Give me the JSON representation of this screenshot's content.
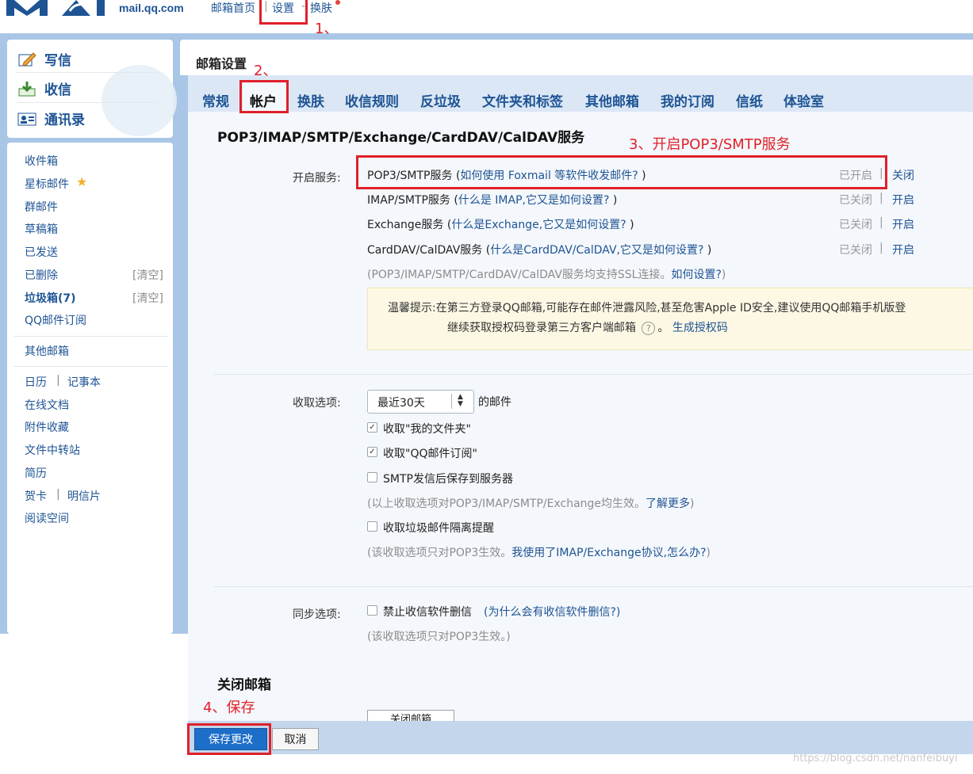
{
  "header": {
    "domain": "mail.qq.com",
    "nav": [
      {
        "label": "邮箱首页"
      },
      {
        "label": "设置"
      },
      {
        "label": "换肤"
      }
    ]
  },
  "sidebar": {
    "primary": [
      {
        "label": "写信",
        "icon": "pencil-icon"
      },
      {
        "label": "收信",
        "icon": "inbox-download-icon"
      },
      {
        "label": "通讯录",
        "icon": "contact-card-icon"
      }
    ],
    "folders": [
      {
        "label": "收件箱"
      },
      {
        "label": "星标邮件"
      },
      {
        "label": "群邮件"
      },
      {
        "label": "草稿箱"
      },
      {
        "label": "已发送"
      },
      {
        "label": "已删除",
        "action": "[清空]"
      },
      {
        "label": "垃圾箱(7)",
        "action": "[清空]"
      },
      {
        "label": "QQ邮件订阅"
      }
    ],
    "other_mail": "其他邮箱",
    "tools": {
      "calendar": "日历",
      "notes": "记事本",
      "online_docs": "在线文档",
      "attachments": "附件收藏",
      "file_transfer": "文件中转站",
      "resume": "简历",
      "greeting_card": "贺卡",
      "postcard": "明信片",
      "reading_space": "阅读空间"
    },
    "tool_sep": "|"
  },
  "main": {
    "title": "邮箱设置",
    "tabs": [
      {
        "label": "常规"
      },
      {
        "label": "帐户"
      },
      {
        "label": "换肤"
      },
      {
        "label": "收信规则"
      },
      {
        "label": "反垃圾"
      },
      {
        "label": "文件夹和标签"
      },
      {
        "label": "其他邮箱"
      },
      {
        "label": "我的订阅"
      },
      {
        "label": "信纸"
      },
      {
        "label": "体验室"
      }
    ],
    "services": {
      "title": "POP3/IMAP/SMTP/Exchange/CardDAV/CalDAV服务",
      "label": "开启服务:",
      "rows": [
        {
          "name": "POP3/SMTP服务",
          "help": "如何使用 Foxmail 等软件收发邮件?",
          "status": "已开启",
          "action": "关闭"
        },
        {
          "name": "IMAP/SMTP服务",
          "help": "什么是 IMAP,它又是如何设置?",
          "status": "已关闭",
          "action": "开启"
        },
        {
          "name": "Exchange服务",
          "help": "什么是Exchange,它又是如何设置?",
          "status": "已关闭",
          "action": "开启"
        },
        {
          "name": "CardDAV/CalDAV服务",
          "help": "什么是CardDAV/CalDAV,它又是如何设置?",
          "status": "已关闭",
          "action": "开启"
        }
      ],
      "ssl_note_prefix": "(POP3/IMAP/SMTP/CardDAV/CalDAV服务均支持SSL连接。",
      "ssl_note_link": "如何设置?",
      "ssl_note_suffix": ")",
      "tip_line1": "温馨提示:在第三方登录QQ邮箱,可能存在邮件泄露风险,甚至危害Apple ID安全,建议使用QQ邮箱手机版登",
      "tip_line2": "继续获取授权码登录第三方客户端邮箱",
      "tip_link": "生成授权码"
    },
    "fetch": {
      "label": "收取选项:",
      "select_value": "最近30天",
      "select_suffix": "的邮件",
      "options": [
        {
          "label": "收取\"我的文件夹\"",
          "checked": true
        },
        {
          "label": "收取\"QQ邮件订阅\"",
          "checked": true
        },
        {
          "label": "SMTP发信后保存到服务器",
          "checked": false
        }
      ],
      "note1_prefix": "(以上收取选项对POP3/IMAP/SMTP/Exchange均生效。",
      "note1_link": "了解更多",
      "note1_suffix": ")",
      "junk_option": {
        "label": "收取垃圾邮件隔离提醒",
        "checked": false
      },
      "note2_prefix": "(该收取选项只对POP3生效。",
      "note2_link": "我使用了IMAP/Exchange协议,怎么办?",
      "note2_suffix": ")"
    },
    "sync": {
      "label": "同步选项:",
      "option": {
        "label": "禁止收信软件删信",
        "checked": false
      },
      "help": "(为什么会有收信软件删信?)",
      "note": "(该收取选项只对POP3生效。)"
    },
    "close_mailbox": {
      "title": "关闭邮箱",
      "button": "关闭邮箱"
    }
  },
  "footer": {
    "save": "保存更改",
    "cancel": "取消"
  },
  "annotations": {
    "step1": "1、",
    "step2": "2、",
    "step3": "3、开启POP3/SMTP服务",
    "step4": "4、保存",
    "color": "#e0202a"
  },
  "watermark": "https://blog.csdn.net/nanfeibuyi"
}
